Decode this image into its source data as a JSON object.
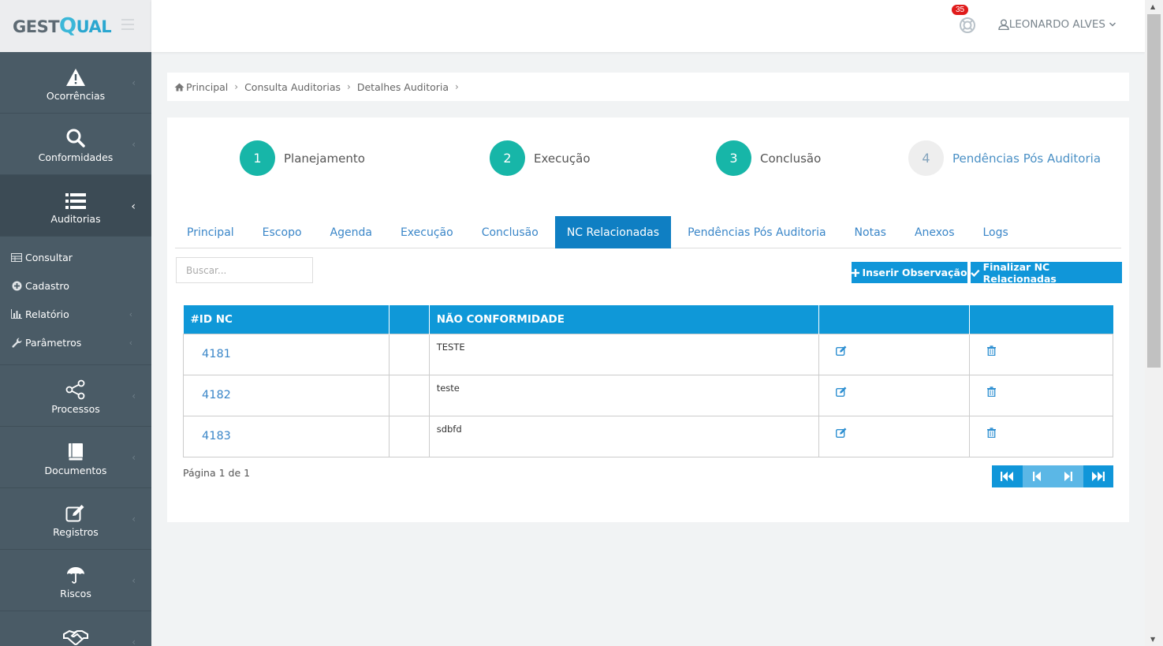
{
  "app": {
    "logo_text_1": "GEST",
    "logo_text_2": "Q",
    "logo_text_3": "UAL"
  },
  "sidebar": {
    "items_top": [
      {
        "label": "Ocorrências",
        "icon": "warning-icon"
      },
      {
        "label": "Conformidades",
        "icon": "search-icon"
      },
      {
        "label": "Auditorias",
        "icon": "list-icon",
        "active": true
      }
    ],
    "submenu": [
      {
        "label": "Consultar",
        "icon": "table-icon"
      },
      {
        "label": "Cadastro",
        "icon": "plus-circle-icon"
      },
      {
        "label": "Relatório",
        "icon": "bar-chart-icon"
      },
      {
        "label": "Parâmetros",
        "icon": "wrench-icon"
      }
    ],
    "items_bottom": [
      {
        "label": "Processos",
        "icon": "share-icon"
      },
      {
        "label": "Documentos",
        "icon": "book-icon"
      },
      {
        "label": "Registros",
        "icon": "edit-icon"
      },
      {
        "label": "Riscos",
        "icon": "umbrella-icon"
      },
      {
        "label": "",
        "icon": "handshake-icon"
      }
    ]
  },
  "header": {
    "notification_count": "35",
    "user_name": "LEONARDO ALVES"
  },
  "breadcrumb": [
    "Principal",
    "Consulta Auditorias",
    "Detalhes Auditoria"
  ],
  "steps": [
    {
      "number": "1",
      "label": "Planejamento",
      "state": "done"
    },
    {
      "number": "2",
      "label": "Execução",
      "state": "done"
    },
    {
      "number": "3",
      "label": "Conclusão",
      "state": "done"
    },
    {
      "number": "4",
      "label": "Pendências Pós Auditoria",
      "state": "pending"
    }
  ],
  "tabs": [
    "Principal",
    "Escopo",
    "Agenda",
    "Execução",
    "Conclusão",
    "NC Relacionadas",
    "Pendências Pós Auditoria",
    "Notas",
    "Anexos",
    "Logs"
  ],
  "active_tab": "NC Relacionadas",
  "search": {
    "placeholder": "Buscar..."
  },
  "buttons": {
    "insert": "Inserir Observação",
    "finalize": "Finalizar NC Relacionadas"
  },
  "table": {
    "headers": [
      "#ID NC",
      "",
      "NÃO CONFORMIDADE",
      "",
      ""
    ],
    "rows": [
      {
        "id": "4181",
        "description": "TESTE"
      },
      {
        "id": "4182",
        "description": "teste"
      },
      {
        "id": "4183",
        "description": "sdbfd"
      }
    ]
  },
  "pagination": {
    "info": "Página 1 de 1"
  },
  "colors": {
    "sidebar": "#4a5b66",
    "accent": "#1096d9",
    "step": "#17b6a8",
    "active_tab": "#0f7fc3"
  }
}
